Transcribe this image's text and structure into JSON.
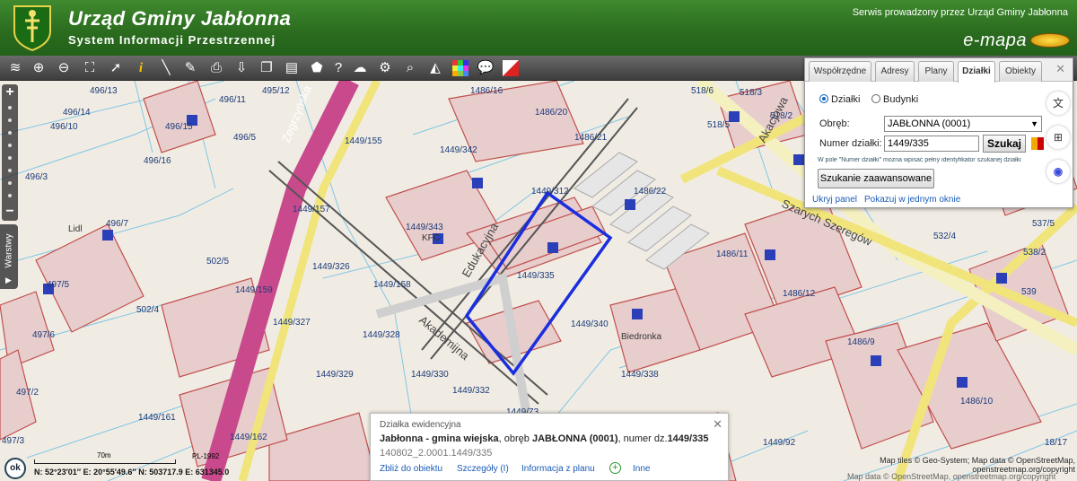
{
  "header": {
    "title": "Urząd Gminy Jabłonna",
    "subtitle": "System Informacji Przestrzennej",
    "service": "Serwis prowadzony przez Urząd Gminy Jabłonna",
    "brand": "e-mapa",
    "colors": {
      "header_green": "#2a6b1e",
      "toolbar": "#4a4a4a"
    }
  },
  "toolbar": {
    "tools": [
      "layers-icon",
      "zoom-in-icon",
      "zoom-out-icon",
      "zoom-extent-icon",
      "pointer-icon",
      "info-icon",
      "measure-distance-icon",
      "measure-area-icon",
      "print-icon",
      "download-icon",
      "copy-icon",
      "layout-icon",
      "shape-icon",
      "help-icon",
      "cloud-icon",
      "settings-icon",
      "search-map-icon",
      "triangle-icon",
      "color-grid-icon",
      "comment-icon",
      "clear-icon"
    ]
  },
  "zoom": {
    "plus": "+",
    "minus": "−"
  },
  "layers_tab": {
    "label": "Warstwy"
  },
  "panel": {
    "tabs": [
      "Współrzędne",
      "Adresy",
      "Plany",
      "Działki",
      "Obiekty"
    ],
    "active_tab": "Działki",
    "radio_dzialki": "Działki",
    "radio_budynki": "Budynki",
    "obreb_label": "Obręb:",
    "obreb_value": "JABŁONNA (0001)",
    "numer_label": "Numer działki:",
    "numer_value": "1449/335",
    "search_button": "Szukaj",
    "hint": "W pole \"Numer działki\" można wpisać pełny identyfikator szukanej działki",
    "advanced_button": "Szukanie zaawansowane",
    "hide_link": "Ukryj panel",
    "one_window_link": "Pokazuj w jednym oknie"
  },
  "map": {
    "highlight_color": "#1a2ee0",
    "streets": [
      "Zegrzyńska",
      "Akademijna",
      "Edukacyjna",
      "Szarych Szeregów",
      "Akacjowa"
    ],
    "pois": [
      "Lidl",
      "KFC",
      "Biedronka"
    ],
    "parcels": [
      "496/13",
      "496/14",
      "496/10",
      "496/11",
      "495/12",
      "496/15",
      "496/5",
      "496/16",
      "496/3",
      "496/7",
      "497/5",
      "502/5",
      "502/4",
      "497/6",
      "497/2",
      "497/3",
      "1486/16",
      "1486/20",
      "1486/21",
      "1486/22",
      "1449/155",
      "1449/342",
      "1449/343",
      "1449/312",
      "1449/157",
      "1449/326",
      "1449/158",
      "1449/159",
      "1449/327",
      "1449/328",
      "1449/329",
      "1449/330",
      "1449/332",
      "1449/161",
      "1449/162",
      "1449/73",
      "1449/335",
      "1449/340",
      "1449/338",
      "518/6",
      "518/3",
      "518/5",
      "518/2",
      "1486/11",
      "1486/12",
      "1486/9",
      "1486/10",
      "1449/92",
      "537/5",
      "538/2",
      "532/4",
      "539",
      "18/17"
    ]
  },
  "info": {
    "heading": "Działka ewidencyjna",
    "gmina": "Jabłonna - gmina wiejska",
    "obreb_prefix": ", obręb ",
    "obreb": "JABŁONNA (0001)",
    "numer_prefix": ", numer dz.",
    "numer": "1449/335",
    "identifier": "140802_2.0001.1449/335",
    "links": [
      "Zbliż do obiektu",
      "Szczegóły (I)",
      "Informacja z planu",
      "Inne"
    ]
  },
  "bottom": {
    "ok": "ok",
    "scale": "70m",
    "crs": "PL-1992",
    "coords": "N: 52°23′01″   E: 20°55′49.6″   N: 503717.9   E: 631345.0",
    "attribution": "Map tiles © Geo-System; Map data © OpenStreetMap,",
    "attribution_line2": "openstreetmap.org/copyright",
    "attribution_faded": "Map data © OpenStreetMap, openstreetmap.org/copyright"
  }
}
